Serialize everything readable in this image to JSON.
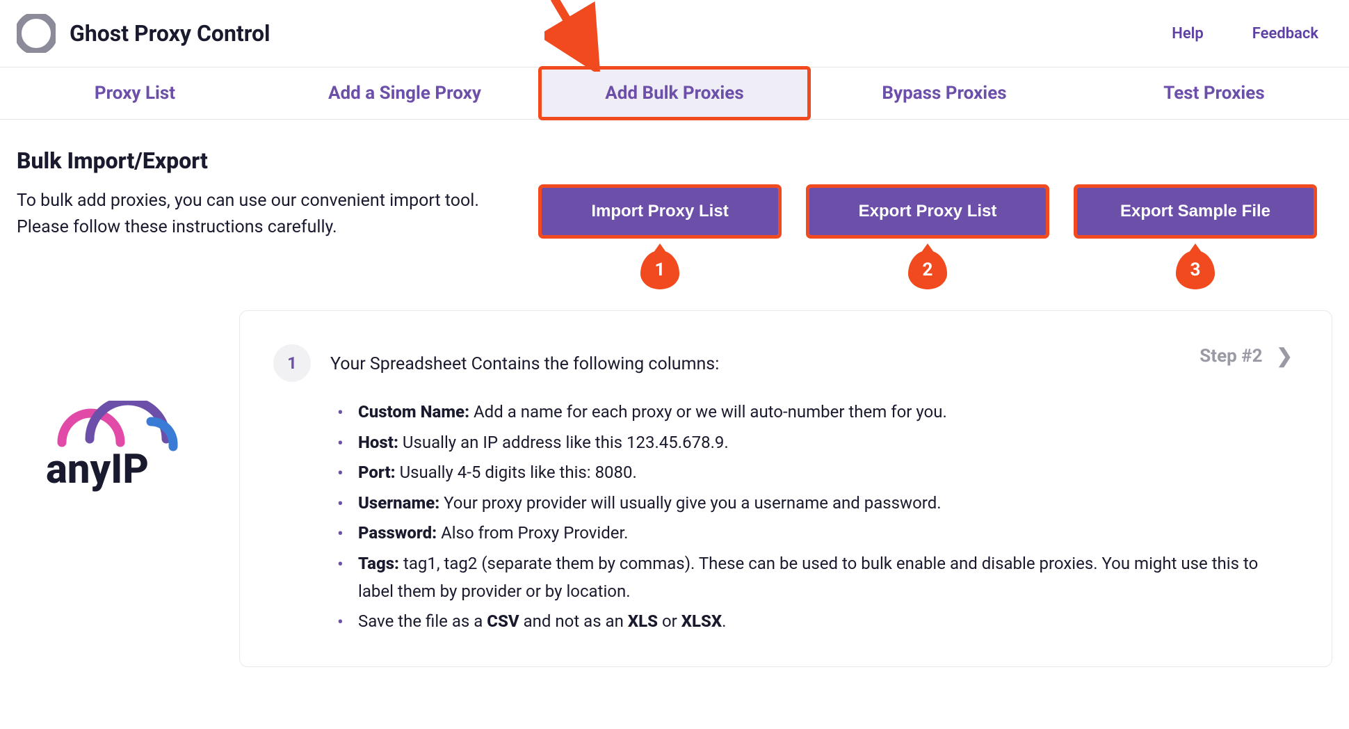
{
  "header": {
    "app_title": "Ghost Proxy Control",
    "links": {
      "help": "Help",
      "feedback": "Feedback"
    }
  },
  "tabs": {
    "items": [
      {
        "label": "Proxy List"
      },
      {
        "label": "Add a Single Proxy"
      },
      {
        "label": "Add Bulk Proxies"
      },
      {
        "label": "Bypass Proxies"
      },
      {
        "label": "Test Proxies"
      }
    ],
    "active_index": 2
  },
  "section": {
    "title": "Bulk Import/Export",
    "description": "To bulk add proxies, you can use our convenient import tool. Please follow these instructions carefully.",
    "buttons": [
      {
        "label": "Import Proxy List",
        "num": "1"
      },
      {
        "label": "Export Proxy List",
        "num": "2"
      },
      {
        "label": "Export Sample File",
        "num": "3"
      }
    ]
  },
  "card": {
    "step_num": "1",
    "lead": "Your Spreadsheet Contains the following columns:",
    "next_label": "Step #2",
    "bullets": [
      {
        "bold": "Custom Name:",
        "text": " Add a name for each proxy or we will auto-number them for you."
      },
      {
        "bold": "Host:",
        "text": " Usually an IP address like this 123.45.678.9."
      },
      {
        "bold": "Port:",
        "text": " Usually 4-5 digits like this: 8080."
      },
      {
        "bold": "Username:",
        "text": " Your proxy provider will usually give you a username and password."
      },
      {
        "bold": "Password:",
        "text": " Also from Proxy Provider."
      },
      {
        "bold": "Tags:",
        "text": " tag1, tag2 (separate them by commas). These can be used to bulk enable and disable proxies. You might use this to label them by provider or by location."
      }
    ],
    "save_line": {
      "pre": "Save the file as a ",
      "b1": "CSV",
      "mid": " and not as an ",
      "b2": "XLS",
      "or": " or ",
      "b3": "XLSX",
      "post": "."
    }
  },
  "brand": {
    "name": "anyIP"
  },
  "annotations": {
    "arrow_target": "Add Bulk Proxies"
  }
}
